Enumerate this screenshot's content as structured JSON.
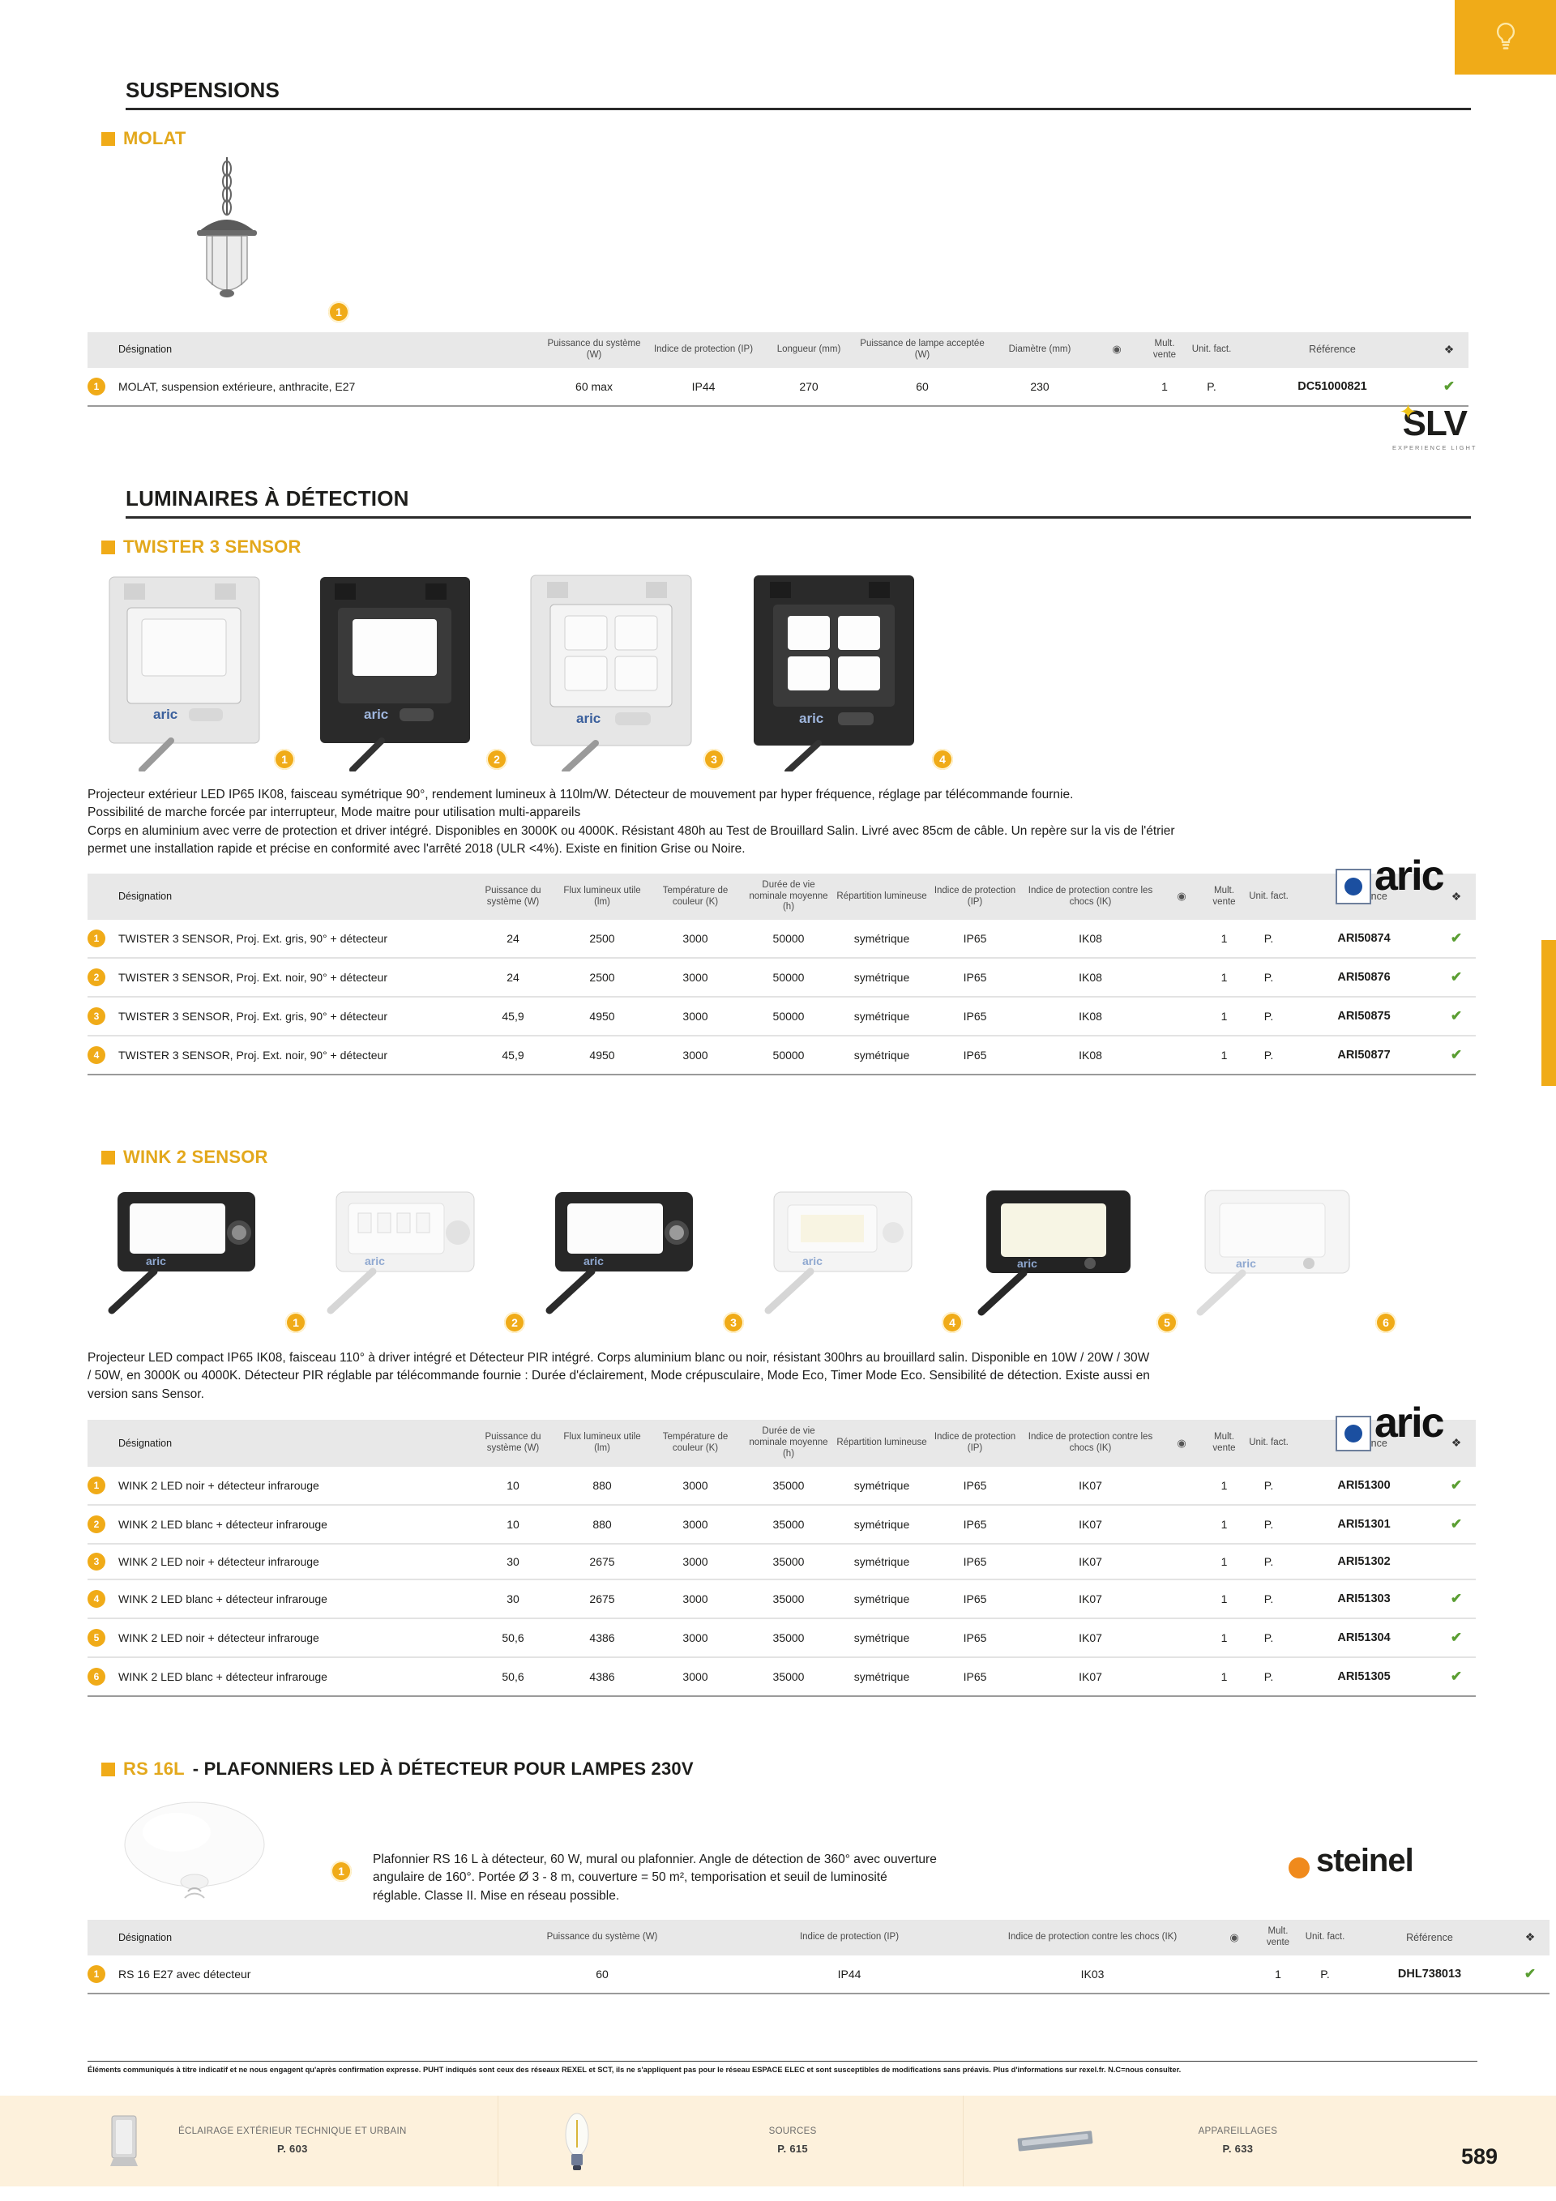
{
  "page": {
    "number": "589",
    "top_tab_icon": "bulb-icon",
    "accent": "#f0ab18"
  },
  "sections": [
    {
      "id": "suspensions",
      "title": "SUSPENSIONS",
      "family": {
        "name": "MOLAT",
        "suffix": ""
      },
      "brand": "SLV",
      "brand_tagline": "EXPERIENCE LIGHT",
      "images": [
        {
          "badge": "1"
        }
      ],
      "description": [],
      "table": {
        "headers": [
          "Désignation",
          "Puissance du système (W)",
          "Indice de protection (IP)",
          "Longueur (mm)",
          "Puissance de lampe acceptée (W)",
          "Diamètre (mm)",
          "wifi-icon",
          "Mult. vente",
          "Unit. fact.",
          "Référence",
          "stack-icon"
        ],
        "rows": [
          {
            "num": "1",
            "designation": "MOLAT, suspension extérieure, anthracite, E27",
            "cells": [
              "60 max",
              "IP44",
              "270",
              "60",
              "230",
              "",
              "1",
              "P."
            ],
            "reference": "DC51000821",
            "check": "✔"
          }
        ]
      }
    },
    {
      "id": "luminaires-detection",
      "title": "LUMINAIRES À DÉTECTION",
      "family": {
        "name": "TWISTER 3 SENSOR",
        "suffix": ""
      },
      "brand": "aric",
      "images": [
        {
          "badge": "1"
        },
        {
          "badge": "2"
        },
        {
          "badge": "3"
        },
        {
          "badge": "4"
        }
      ],
      "description": [
        "Projecteur extérieur LED IP65 IK08, faisceau symétrique 90°, rendement lumineux à 110lm/W. Détecteur de mouvement par hyper fréquence, réglage par télécommande fournie.",
        "Possibilité de marche forcée par interrupteur, Mode maitre pour utilisation multi-appareils",
        "Corps en aluminium avec verre de protection et driver intégré. Disponibles en 3000K ou 4000K. Résistant 480h au Test de Brouillard Salin. Livré avec 85cm de câble. Un repère sur la vis de l'étrier",
        "permet une installation rapide et précise en conformité avec l'arrêté 2018 (ULR <4%). Existe en finition Grise ou Noire."
      ],
      "table": {
        "headers": [
          "Désignation",
          "Puissance du système (W)",
          "Flux lumineux utile (lm)",
          "Température de couleur (K)",
          "Durée de vie nominale moyenne (h)",
          "Répartition lumineuse",
          "Indice de protection (IP)",
          "Indice de protection contre les chocs (IK)",
          "wifi-icon",
          "Mult. vente",
          "Unit. fact.",
          "Référence",
          "stack-icon"
        ],
        "rows": [
          {
            "num": "1",
            "designation": "TWISTER 3 SENSOR, Proj. Ext. gris, 90° + détecteur",
            "cells": [
              "24",
              "2500",
              "3000",
              "50000",
              "symétrique",
              "IP65",
              "IK08",
              "",
              "1",
              "P."
            ],
            "reference": "ARI50874",
            "check": "✔"
          },
          {
            "num": "2",
            "designation": "TWISTER 3 SENSOR, Proj. Ext. noir, 90° + détecteur",
            "cells": [
              "24",
              "2500",
              "3000",
              "50000",
              "symétrique",
              "IP65",
              "IK08",
              "",
              "1",
              "P."
            ],
            "reference": "ARI50876",
            "check": "✔"
          },
          {
            "num": "3",
            "designation": "TWISTER 3 SENSOR, Proj. Ext. gris, 90° + détecteur",
            "cells": [
              "45,9",
              "4950",
              "3000",
              "50000",
              "symétrique",
              "IP65",
              "IK08",
              "",
              "1",
              "P."
            ],
            "reference": "ARI50875",
            "check": "✔"
          },
          {
            "num": "4",
            "designation": "TWISTER 3 SENSOR, Proj. Ext. noir, 90° + détecteur",
            "cells": [
              "45,9",
              "4950",
              "3000",
              "50000",
              "symétrique",
              "IP65",
              "IK08",
              "",
              "1",
              "P."
            ],
            "reference": "ARI50877",
            "check": "✔"
          }
        ]
      }
    },
    {
      "id": "wink2",
      "title": "",
      "family": {
        "name": "WINK 2 SENSOR",
        "suffix": ""
      },
      "brand": "aric",
      "images": [
        {
          "badge": "1"
        },
        {
          "badge": "2"
        },
        {
          "badge": "3"
        },
        {
          "badge": "4"
        },
        {
          "badge": "5"
        },
        {
          "badge": "6"
        }
      ],
      "description": [
        "Projecteur LED compact IP65 IK08, faisceau 110° à driver intégré et Détecteur PIR intégré. Corps aluminium blanc ou noir, résistant 300hrs au brouillard salin. Disponible en 10W / 20W / 30W",
        "/ 50W, en 3000K ou 4000K. Détecteur PIR réglable par télécommande fournie : Durée d'éclairement, Mode crépusculaire, Mode Eco, Timer Mode Eco. Sensibilité de détection. Existe aussi en",
        "version sans Sensor."
      ],
      "table": {
        "headers": [
          "Désignation",
          "Puissance du système (W)",
          "Flux lumineux utile (lm)",
          "Température de couleur (K)",
          "Durée de vie nominale moyenne (h)",
          "Répartition lumineuse",
          "Indice de protection (IP)",
          "Indice de protection contre les chocs (IK)",
          "wifi-icon",
          "Mult. vente",
          "Unit. fact.",
          "Référence",
          "stack-icon"
        ],
        "rows": [
          {
            "num": "1",
            "designation": "WINK 2 LED noir + détecteur infrarouge",
            "cells": [
              "10",
              "880",
              "3000",
              "35000",
              "symétrique",
              "IP65",
              "IK07",
              "",
              "1",
              "P."
            ],
            "reference": "ARI51300",
            "check": "✔"
          },
          {
            "num": "2",
            "designation": "WINK 2 LED blanc + détecteur infrarouge",
            "cells": [
              "10",
              "880",
              "3000",
              "35000",
              "symétrique",
              "IP65",
              "IK07",
              "",
              "1",
              "P."
            ],
            "reference": "ARI51301",
            "check": "✔"
          },
          {
            "num": "3",
            "designation": "WINK 2 LED noir + détecteur infrarouge",
            "cells": [
              "30",
              "2675",
              "3000",
              "35000",
              "symétrique",
              "IP65",
              "IK07",
              "",
              "1",
              "P."
            ],
            "reference": "ARI51302",
            "check": ""
          },
          {
            "num": "4",
            "designation": "WINK 2 LED blanc + détecteur infrarouge",
            "cells": [
              "30",
              "2675",
              "3000",
              "35000",
              "symétrique",
              "IP65",
              "IK07",
              "",
              "1",
              "P."
            ],
            "reference": "ARI51303",
            "check": "✔"
          },
          {
            "num": "5",
            "designation": "WINK 2 LED noir + détecteur infrarouge",
            "cells": [
              "50,6",
              "4386",
              "3000",
              "35000",
              "symétrique",
              "IP65",
              "IK07",
              "",
              "1",
              "P."
            ],
            "reference": "ARI51304",
            "check": "✔"
          },
          {
            "num": "6",
            "designation": "WINK 2 LED blanc + détecteur infrarouge",
            "cells": [
              "50,6",
              "4386",
              "3000",
              "35000",
              "symétrique",
              "IP65",
              "IK07",
              "",
              "1",
              "P."
            ],
            "reference": "ARI51305",
            "check": "✔"
          }
        ]
      }
    },
    {
      "id": "rs16l",
      "title": "",
      "family": {
        "name": "RS 16L",
        "suffix": " - PLAFONNIERS LED À DÉTECTEUR POUR LAMPES 230V"
      },
      "brand": "steinel",
      "images": [
        {
          "badge": "1"
        }
      ],
      "description": [
        "Plafonnier RS 16 L à détecteur, 60 W, mural ou plafonnier. Angle de détection de 360° avec ouverture",
        "angulaire de 160°. Portée Ø 3 - 8 m, couverture = 50 m², temporisation et seuil de luminosité",
        "réglable. Classe II. Mise en réseau possible."
      ],
      "table": {
        "headers": [
          "Désignation",
          "Puissance du système (W)",
          "Indice de protection (IP)",
          "Indice de protection contre les chocs (IK)",
          "wifi-icon",
          "Mult. vente",
          "Unit. fact.",
          "Référence",
          "stack-icon"
        ],
        "rows": [
          {
            "num": "1",
            "designation": "RS 16 E27 avec détecteur",
            "cells": [
              "60",
              "IP44",
              "IK03",
              "",
              "1",
              "P."
            ],
            "reference": "DHL738013",
            "check": "✔"
          }
        ]
      }
    }
  ],
  "footer": {
    "disclaimer": "Éléments communiqués à titre indicatif et ne nous engagent qu'après confirmation expresse. PUHT indiqués sont ceux des réseaux REXEL et SCT, ils ne s'appliquent pas pour le réseau ESPACE ELEC et sont susceptibles de modifications sans préavis. Plus d'informations sur rexel.fr. N.C=nous consulter.",
    "nav": [
      {
        "icon": "floodlight-icon",
        "label": "ÉCLAIRAGE EXTÉRIEUR TECHNIQUE ET URBAIN",
        "page": "P. 603"
      },
      {
        "icon": "bulb-icon",
        "label": "SOURCES",
        "page": "P. 615"
      },
      {
        "icon": "driver-icon",
        "label": "APPAREILLAGES",
        "page": "P. 633"
      }
    ]
  }
}
